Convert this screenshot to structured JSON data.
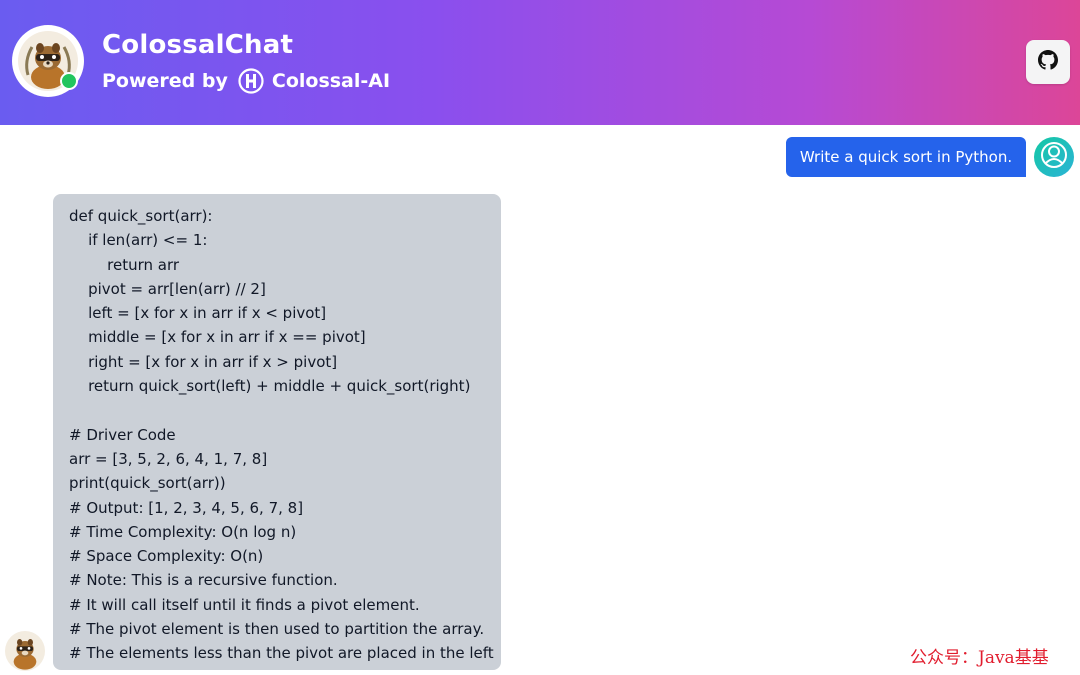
{
  "header": {
    "title": "ColossalChat",
    "powered_by": "Powered by",
    "brand_name": "Colossal-AI",
    "github_icon": "github-icon",
    "online_color": "#22c55e"
  },
  "user_message": {
    "text": "Write a quick sort in Python.",
    "avatar_icon": "user-icon",
    "bubble_color": "#2563eb"
  },
  "bot_message": {
    "avatar_icon": "raccoon-logo",
    "lines": [
      "def quick_sort(arr):",
      "    if len(arr) <= 1:",
      "        return arr",
      "    pivot = arr[len(arr) // 2]",
      "    left = [x for x in arr if x < pivot]",
      "    middle = [x for x in arr if x == pivot]",
      "    right = [x for x in arr if x > pivot]",
      "    return quick_sort(left) + middle + quick_sort(right)",
      "",
      "# Driver Code",
      "arr = [3, 5, 2, 6, 4, 1, 7, 8]",
      "print(quick_sort(arr))",
      "# Output: [1, 2, 3, 4, 5, 6, 7, 8]",
      "# Time Complexity: O(n log n)",
      "# Space Complexity: O(n)",
      "# Note: This is a recursive function.",
      "# It will call itself until it finds a pivot element.",
      "# The pivot element is then used to partition the array.",
      "# The elements less than the pivot are placed in the left"
    ]
  },
  "watermark": "公众号：Java基基"
}
